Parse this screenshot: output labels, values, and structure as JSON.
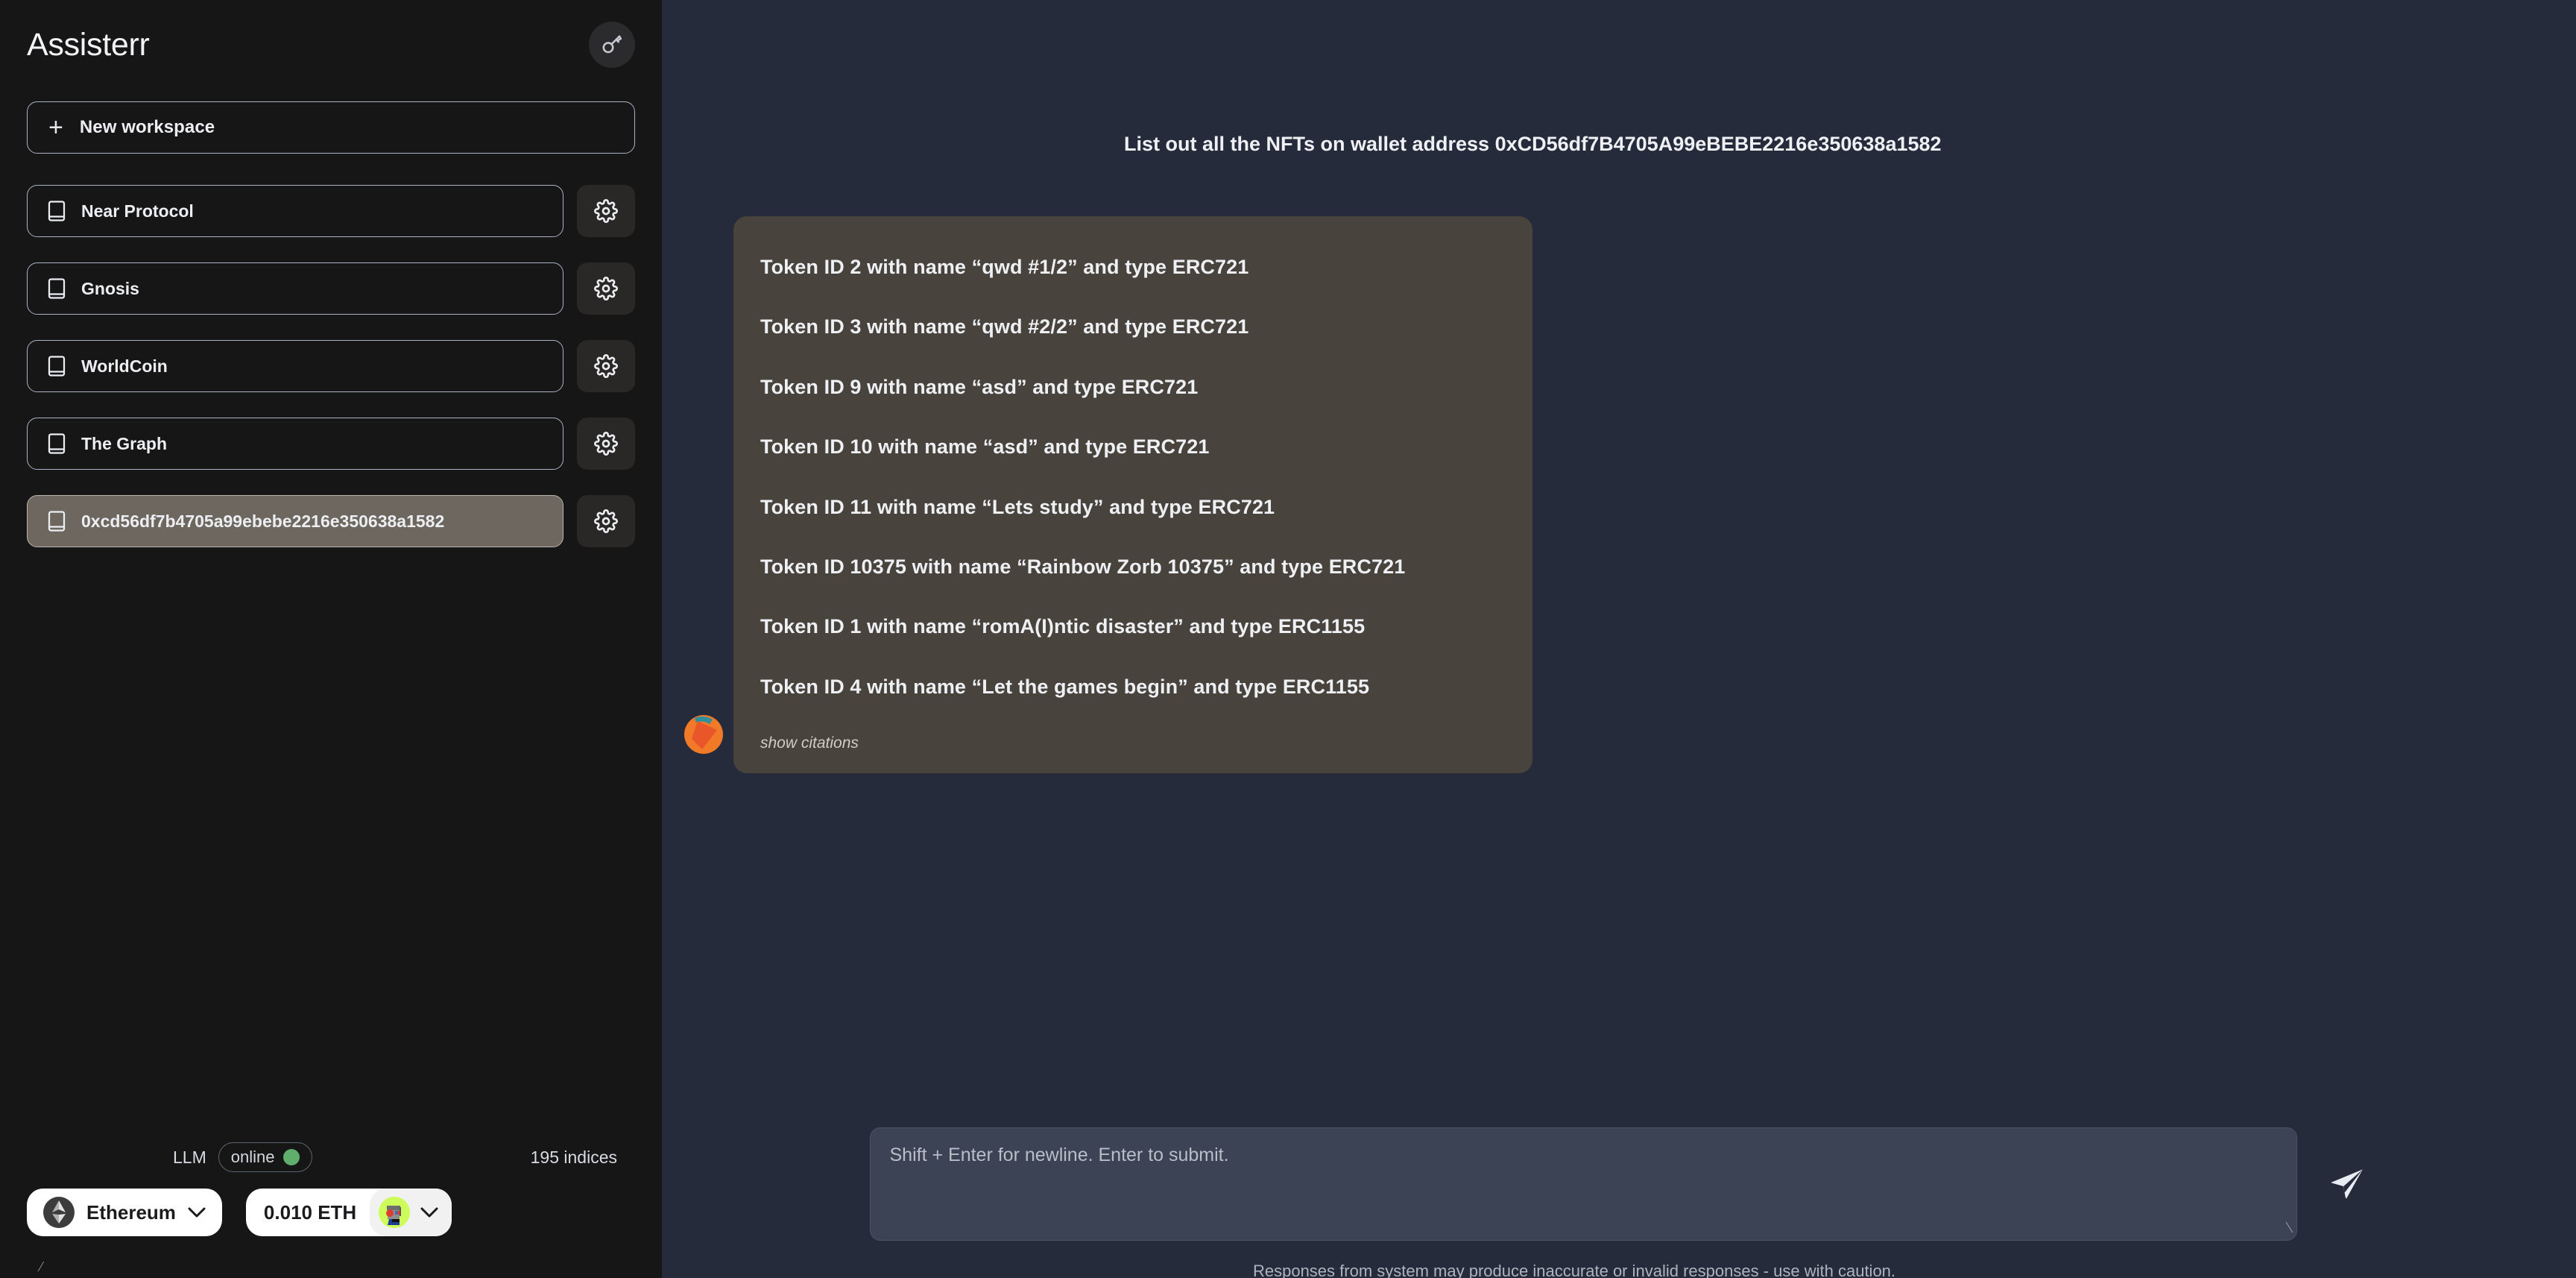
{
  "sidebar": {
    "app_title": "Assisterr",
    "key_button_icon": "key-icon",
    "new_workspace": {
      "label": "New workspace",
      "icon": "plus-icon"
    },
    "workspaces": [
      {
        "name": "Near Protocol",
        "icon": "book-icon",
        "settings_icon": "gear-icon",
        "selected": false
      },
      {
        "name": "Gnosis",
        "icon": "book-icon",
        "settings_icon": "gear-icon",
        "selected": false
      },
      {
        "name": "WorldCoin",
        "icon": "book-icon",
        "settings_icon": "gear-icon",
        "selected": false
      },
      {
        "name": "The Graph",
        "icon": "book-icon",
        "settings_icon": "gear-icon",
        "selected": false
      },
      {
        "name": "0xcd56df7b4705a99ebebe2216e350638a1582",
        "icon": "book-icon",
        "settings_icon": "gear-icon",
        "selected": true
      }
    ],
    "status": {
      "llm_label": "LLM",
      "online_label": "online",
      "online_color": "#5fae6b",
      "indices_label": "195 indices"
    },
    "wallet": {
      "chain_label": "Ethereum",
      "chain_icon": "ethereum-icon",
      "chain_chevron": "chevron-down-icon",
      "balance_label": "0.010 ETH",
      "avatar_icon": "cryptopunk-avatar",
      "balance_chevron": "chevron-down-icon"
    },
    "corner_mark": "⁄"
  },
  "chat": {
    "user_message": "List out all the NFTs on wallet address 0xCD56df7B4705A99eBEBE2216e350638a1582",
    "assistant_avatar_icon": "assisterr-logo-avatar",
    "assistant_lines": [
      "Token ID 2 with name “qwd #1/2” and type ERC721",
      "Token ID 3 with name “qwd #2/2” and type ERC721",
      "Token ID 9 with name “asd” and type ERC721",
      "Token ID 10 with name “asd” and type ERC721",
      "Token ID 11 with name “Lets study” and type ERC721",
      "Token ID 10375 with name “Rainbow Zorb 10375” and type ERC721",
      "Token ID 1 with name “romA(I)ntic disaster” and type ERC1155",
      "Token ID 4 with name “Let the games begin” and type ERC1155"
    ],
    "show_citations_label": "show citations"
  },
  "composer": {
    "placeholder": "Shift + Enter for newline. Enter to submit.",
    "value": "",
    "send_icon": "send-icon",
    "resize_handle": "⁄",
    "disclaimer": "Responses from system may produce inaccurate or invalid responses - use with caution."
  },
  "colors": {
    "sidebar_bg": "#161617",
    "main_bg": "#252b3a",
    "bubble_bg": "#48433d",
    "selected_ws_bg": "#6d6760",
    "composer_bg": "#3c4354",
    "accent_orange": "#ee6a2a",
    "online_green": "#5fae6b"
  }
}
